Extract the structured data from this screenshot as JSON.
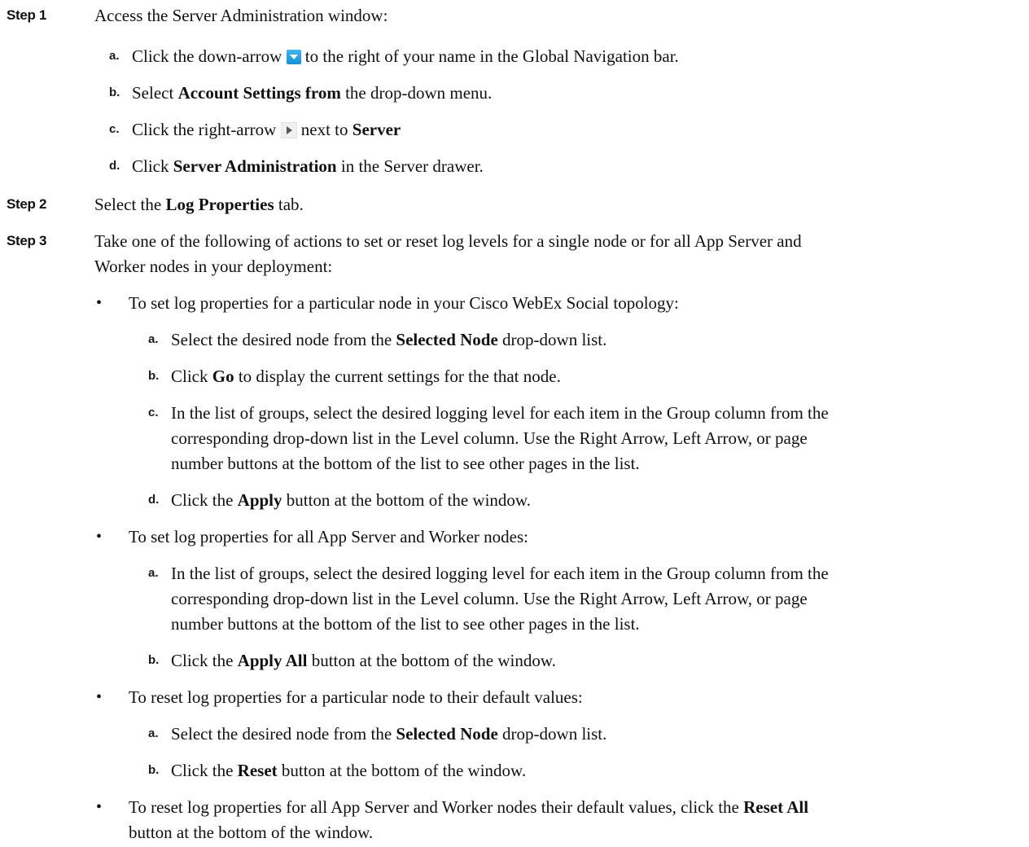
{
  "step1": {
    "label": "Step 1",
    "text": "Access the Server Administration window:",
    "items": [
      {
        "marker": "a.",
        "pre": "Click the down-arrow",
        "post": "to the right of your name in the Global Navigation bar.",
        "icon": "down-arrow-icon"
      },
      {
        "marker": "b.",
        "pre": "Select ",
        "bold": "Account Settings from",
        "post": " the drop-down menu."
      },
      {
        "marker": "c.",
        "pre": "Click the right-arrow",
        "post": "next to ",
        "bold": "Server",
        "icon": "right-arrow-icon"
      },
      {
        "marker": "d.",
        "pre": "Click ",
        "bold": "Server Administration",
        "post": " in the Server drawer."
      }
    ]
  },
  "step2": {
    "label": "Step 2",
    "pre": "Select the ",
    "bold": "Log Properties",
    "post": " tab."
  },
  "step3": {
    "label": "Step 3",
    "line1": "Take one of the following of actions to set or reset log levels for a single node or for all App Server and",
    "line2": "Worker nodes in your deployment:",
    "bullets": [
      {
        "text": "To set log properties for a particular node in your Cisco WebEx Social topology:",
        "items": [
          {
            "marker": "a.",
            "pre": "Select the desired node from the ",
            "bold": "Selected Node",
            "post": " drop-down list."
          },
          {
            "marker": "b.",
            "pre": "Click ",
            "bold": "Go",
            "post": " to display the current settings for the that node."
          },
          {
            "marker": "c.",
            "lines": [
              "In the list of groups, select the desired logging level for each item in the Group column from the",
              "corresponding drop-down list in the Level column. Use the Right Arrow, Left Arrow, or page",
              "number buttons at the bottom of the list to see other pages in the list."
            ]
          },
          {
            "marker": "d.",
            "pre": "Click the ",
            "bold": "Apply",
            "post": " button at the bottom of the window."
          }
        ]
      },
      {
        "text": "To set log properties for all App Server and Worker nodes:",
        "items": [
          {
            "marker": "a.",
            "lines": [
              "In the list of groups, select the desired logging level for each item in the Group column from the",
              "corresponding drop-down list in the Level column. Use the Right Arrow, Left Arrow, or page",
              "number buttons at the bottom of the list to see other pages in the list."
            ]
          },
          {
            "marker": "b.",
            "pre": "Click the ",
            "bold": "Apply All",
            "post": " button at the bottom of the window."
          }
        ]
      },
      {
        "text": "To reset log properties for a particular node to their default values:",
        "items": [
          {
            "marker": "a.",
            "pre": "Select the desired node from the ",
            "bold": "Selected Node",
            "post": " drop-down list."
          },
          {
            "marker": "b.",
            "pre": "Click the ",
            "bold": "Reset",
            "post": " button at the bottom of the window."
          }
        ]
      },
      {
        "pre": "To reset log properties for all App Server and Worker nodes their default values, click the ",
        "bold": "Reset All",
        "line2": "button at the bottom of the window."
      }
    ]
  }
}
